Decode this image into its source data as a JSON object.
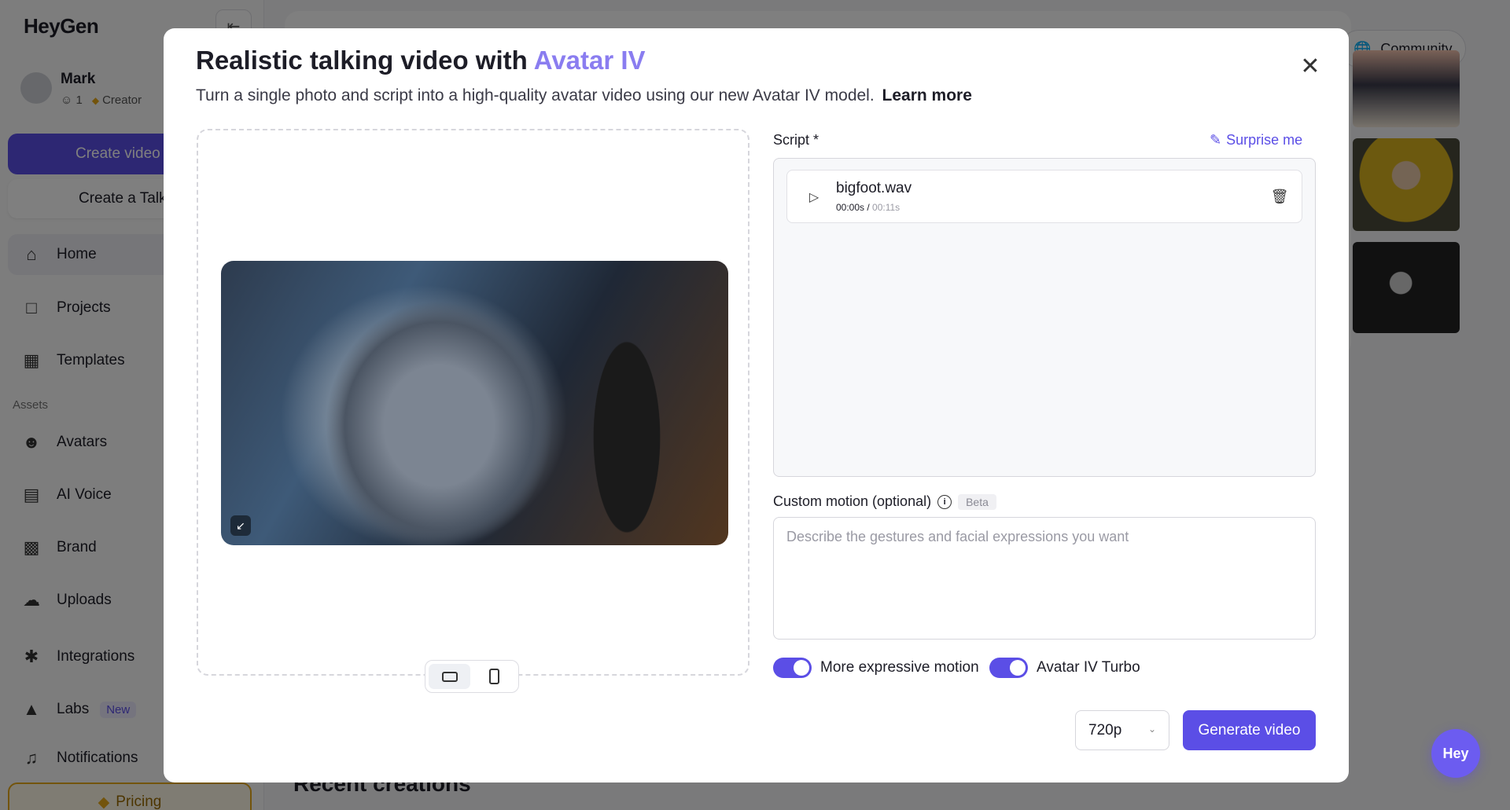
{
  "app": {
    "brand": "HeyGen"
  },
  "user": {
    "name": "Mark",
    "members": "1",
    "plan": "Creator"
  },
  "sidebar": {
    "create_video": "Create video",
    "create_ta": "Create a Talking Photo",
    "assets_label": "Assets",
    "items": [
      {
        "label": "Home",
        "icon": "home-icon"
      },
      {
        "label": "Projects",
        "icon": "folder-icon"
      },
      {
        "label": "Templates",
        "icon": "templates-icon"
      },
      {
        "label": "Avatars",
        "icon": "avatar-icon"
      },
      {
        "label": "AI Voice",
        "icon": "voice-icon"
      },
      {
        "label": "Brand",
        "icon": "brand-icon"
      },
      {
        "label": "Uploads",
        "icon": "upload-icon"
      },
      {
        "label": "Integrations",
        "icon": "puzzle-icon"
      },
      {
        "label": "Labs",
        "icon": "flask-icon",
        "badge": "New"
      },
      {
        "label": "Notifications",
        "icon": "bell-icon"
      }
    ],
    "pricing": "Pricing"
  },
  "main": {
    "community": "Community",
    "recent_title": "Recent creations",
    "hey_button": "Hey"
  },
  "modal": {
    "title_prefix": "Realistic talking video with ",
    "title_accent": "Avatar IV",
    "subtitle": "Turn a single photo and script into a high-quality avatar video using our new Avatar IV model.",
    "learn_more": "Learn more",
    "script_label": "Script *",
    "surprise_me": "Surprise me",
    "audio": {
      "file_name": "bigfoot.wav",
      "current_time": "00:00s",
      "total_time": "00:11s"
    },
    "custom_motion_label": "Custom motion (optional)",
    "beta_badge": "Beta",
    "custom_motion_placeholder": "Describe the gestures and facial expressions you want",
    "custom_motion_value": "",
    "toggles": [
      {
        "label": "More expressive motion",
        "on": true
      },
      {
        "label": "Avatar IV Turbo",
        "on": true
      }
    ],
    "resolution": "720p",
    "generate": "Generate video"
  },
  "colors": {
    "accent": "#5b4ee6",
    "accent_light": "#8a7df0",
    "overlay": "rgba(0,0,0,0.5)"
  }
}
